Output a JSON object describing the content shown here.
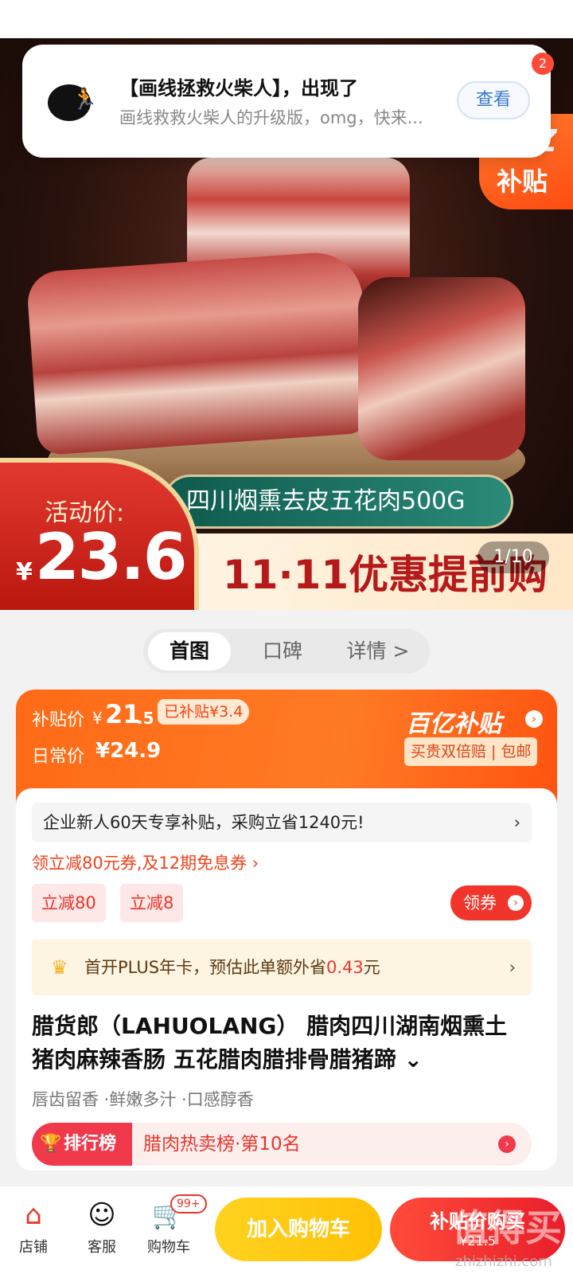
{
  "notification": {
    "title": "【画线拯救火柴人】，出现了",
    "body": "画线救救火柴人的升级版，omg，快来...",
    "action": "查看",
    "badge": "2"
  },
  "hero": {
    "subsidy_tag_1": "Z",
    "subsidy_tag_2": "补贴",
    "product_banner": "四川烟熏去皮五花肉500G",
    "promo": "11·11优惠提前购",
    "price_label": "活动价:",
    "currency": "¥",
    "price": "23.6",
    "image_counter": "1/10"
  },
  "tabs": [
    "首图",
    "口碑",
    "详情 >"
  ],
  "subsidy": {
    "label": "补贴价",
    "currency": "¥",
    "price_int": "21",
    "price_dec": ".5",
    "saved": "已补贴¥3.4",
    "daily_label": "日常价",
    "daily_price": "¥24.9",
    "brand": "百亿补贴",
    "guarantee": "买贵双倍赔 | 包邮"
  },
  "offers": {
    "enterprise": "企业新人60天专享补贴，采购立省1240元!",
    "coupon_line": "领立减80元券,及12期免息券 ›",
    "chip1": "立减80",
    "chip2": "立减8",
    "claim": "领券",
    "plus_text": "首开PLUS年卡，预估此单额外省",
    "plus_amount": "0.43",
    "plus_unit": "元"
  },
  "product": {
    "title": "腊货郎（LAHUOLANG） 腊肉四川湖南烟熏土猪肉麻辣香肠 五花腊肉腊排骨腊猪蹄 ⌄",
    "tags": "唇齿留香 ·鲜嫩多汁 ·口感醇香",
    "rank_tag": "排行榜",
    "rank_text": "腊肉热卖榜·第10名"
  },
  "bottombar": {
    "store": "店铺",
    "service": "客服",
    "cart": "购物车",
    "cart_badge": "99+",
    "add_cart": "加入购物车",
    "buy": "补贴价购买",
    "buy_price": "¥21.5"
  },
  "watermark": {
    "logo": "值得买",
    "site": "zhizhizhi.com"
  },
  "colors": {
    "accent": "#ff5a12",
    "red": "#e8362b",
    "yellow": "#ffc107"
  }
}
